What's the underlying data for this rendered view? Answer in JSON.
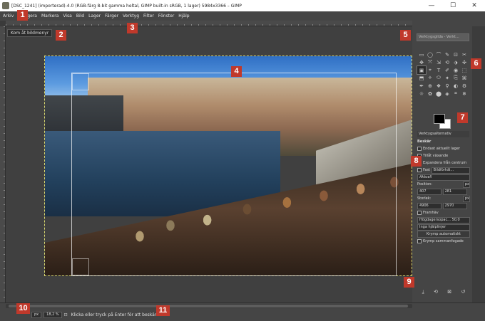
{
  "window": {
    "title": "[DSC_1241] (importerad)-4.0 (RGB-färg 8-bit gamma heltal, GIMP built-in sRGB, 1 lager) 5984x3366 – GIMP",
    "controls": [
      "—",
      "☐",
      "✕"
    ]
  },
  "menubar": [
    "Arkiv",
    "Redigera",
    "Markera",
    "Visa",
    "Bild",
    "Lager",
    "Färger",
    "Verktyg",
    "Filter",
    "Fönster",
    "Hjälp"
  ],
  "canvas": {
    "tooltip": "Kom åt bildmenyr"
  },
  "dock": {
    "search_placeholder": "Verktygsgilda - Verkt...",
    "tool_icons": [
      "▭",
      "◯",
      "⌒",
      "✎",
      "⊡",
      "✂",
      "✥",
      "⤧",
      "⇲",
      "⟲",
      "⬗",
      "✣",
      "▣",
      "⌖",
      "T",
      "✐",
      "◉",
      "⬚",
      "⬒",
      "⟡",
      "⬭",
      "✦",
      "⎘",
      "⌘",
      "✒",
      "⊕",
      "❖",
      "⚲",
      "◐",
      "⚙",
      "☼",
      "✿",
      "⬤",
      "◈",
      "⌗",
      "❄"
    ],
    "tab_label": "Verktygsalternativ",
    "section_title": "Beskär",
    "options": {
      "current_layer": "Endast aktuellt lager",
      "allow_growing": "Tillåt växande",
      "expand_center": "Expandera från centrum",
      "fixed": "Fast",
      "aspect": "Bildförhål...",
      "current": "Aktuell",
      "position_label": "Position:",
      "unit": "px",
      "pos_x": "407",
      "pos_y": "281",
      "size_label": "Storlek:",
      "size_w": "4906",
      "size_h": "2970",
      "highlight": "Framhäv",
      "opacity_label": "Högdagersopac...",
      "opacity_value": "50,0",
      "guides": "Inga hjälplinjer",
      "auto_shrink": "Krymp automatiskt",
      "shrink_merged": "Krymp sammanfogade"
    },
    "bottom_icons": [
      "⤓",
      "⟲",
      "⊠",
      "↺"
    ]
  },
  "statusbar": {
    "unit": "px",
    "zoom": "18,2 %",
    "message": "Klicka eller tryck på Enter för att beskära"
  },
  "callouts": [
    "1",
    "2",
    "3",
    "4",
    "5",
    "6",
    "7",
    "8",
    "9",
    "10",
    "11"
  ]
}
